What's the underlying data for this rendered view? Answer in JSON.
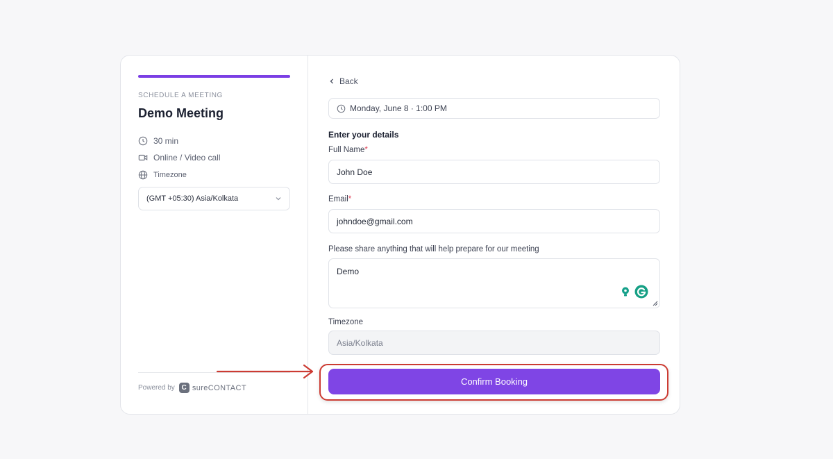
{
  "sidebar": {
    "eyebrow": "SCHEDULE A MEETING",
    "title": "Demo Meeting",
    "duration": "30 min",
    "location": "Online / Video call",
    "timezone_label": "Timezone",
    "timezone_value": "(GMT +05:30) Asia/Kolkata",
    "powered_by": "Powered by",
    "brand_mark": "C",
    "brand_name": "sureCONTACT",
    "accent_color": "#7b3fe4"
  },
  "form": {
    "back_label": "Back",
    "selected_datetime": "Monday, June 8 · 1:00 PM",
    "section_title": "Enter your details",
    "full_name_label": "Full Name",
    "full_name_value": "John Doe",
    "email_label": "Email",
    "email_value": "johndoe@gmail.com",
    "notes_label": "Please share anything that will help prepare for our meeting",
    "notes_value": "Demo",
    "timezone_label": "Timezone",
    "timezone_value": "Asia/Kolkata",
    "required_mark": "*",
    "confirm_label": "Confirm Booking",
    "confirm_color": "#7f45e5",
    "highlight_color": "#cc3b32"
  },
  "icons": {
    "duration": "clock-icon",
    "location": "video-icon",
    "timezone": "globe-icon",
    "datetime": "clock-icon",
    "grammarly_assist": "lightbulb-icon",
    "grammarly": "grammarly-icon"
  }
}
